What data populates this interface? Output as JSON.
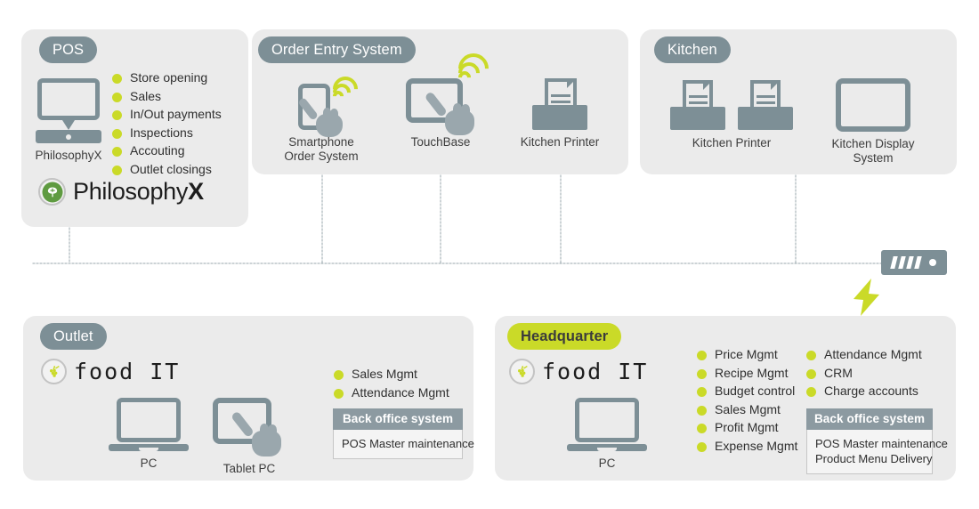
{
  "diagram": {
    "title": "Restaurant system architecture diagram",
    "colors": {
      "panel_bg": "#ebebeb",
      "badge_gray": "#7d8f96",
      "badge_lime": "#cada28",
      "bullet_lime": "#cada28",
      "device_gray": "#7d8f96",
      "hand_gray": "#9aa7ad",
      "text_dark": "#2f2f2f",
      "backoffice_header": "#8c9aa1",
      "backoffice_body": "#f4f4f4",
      "tree_green": "#5f9b41"
    }
  },
  "pos_panel": {
    "badge": "POS",
    "device": {
      "caption": "PhilosophyX",
      "icon": "laptop-icon"
    },
    "features": [
      "Store opening",
      "Sales",
      "In/Out payments",
      "Inspections",
      "Accouting",
      "Outlet closings"
    ],
    "logo": {
      "name_light": "Philosophy",
      "name_bold": "X",
      "icon": "tree-circle-icon"
    }
  },
  "order_entry_panel": {
    "badge": "Order Entry System",
    "devices": [
      {
        "caption": "Smartphone\nOrder System",
        "icon": "smartphone-touch-icon",
        "wifi": true
      },
      {
        "caption": "TouchBase",
        "icon": "tablet-touch-icon",
        "wifi": true
      },
      {
        "caption": "Kitchen Printer",
        "icon": "printer-icon",
        "wifi": false
      }
    ]
  },
  "kitchen_panel": {
    "badge": "Kitchen",
    "devices": [
      {
        "caption": "Kitchen Printer",
        "icon": "printer-icon"
      },
      {
        "caption": "",
        "icon": "printer-icon"
      },
      {
        "caption": "Kitchen Display\nSystem",
        "icon": "display-icon"
      }
    ]
  },
  "outlet_panel": {
    "badge": "Outlet",
    "logo": {
      "text": "food IT",
      "icon": "grapes-circle-icon"
    },
    "devices": [
      {
        "caption": "PC",
        "icon": "pc-icon"
      },
      {
        "caption": "Tablet PC",
        "icon": "tablet-touch-icon"
      }
    ],
    "features": [
      "Sales Mgmt",
      "Attendance Mgmt"
    ],
    "back_office": {
      "header": "Back office system",
      "items": [
        "POS Master maintenance"
      ]
    }
  },
  "headquarter_panel": {
    "badge": "Headquarter",
    "logo": {
      "text": "food IT",
      "icon": "grapes-circle-icon"
    },
    "devices": [
      {
        "caption": "PC",
        "icon": "pc-icon"
      }
    ],
    "features_col1": [
      "Price Mgmt",
      "Recipe Mgmt",
      "Budget control",
      "Sales Mgmt",
      "Profit Mgmt",
      "Expense Mgmt"
    ],
    "features_col2": [
      "Attendance Mgmt",
      "CRM",
      "Charge accounts"
    ],
    "back_office": {
      "header": "Back office system",
      "items": [
        "POS Master maintenance",
        "Product Menu Delivery"
      ]
    }
  },
  "network": {
    "server_icon": "server-icon",
    "bolt_icon": "lightning-bolt-icon"
  }
}
